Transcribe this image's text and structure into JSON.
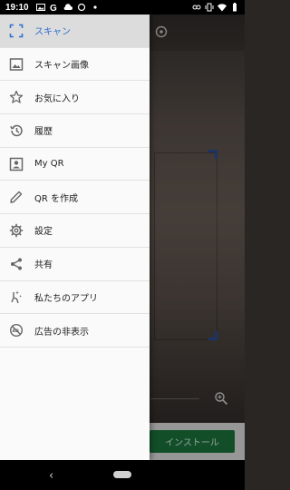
{
  "status_bar": {
    "time": "19:10",
    "left_icons": [
      "image-icon",
      "google-icon",
      "cloud-icon",
      "sync-icon",
      "dot-icon"
    ],
    "right_icons": [
      "link-icon",
      "vibrate-icon",
      "wifi-icon",
      "battery-icon"
    ]
  },
  "drawer": {
    "items": [
      {
        "label": "スキャン",
        "icon": "scan-icon",
        "active": true
      },
      {
        "label": "スキャン画像",
        "icon": "image-icon",
        "active": false
      },
      {
        "label": "お気に入り",
        "icon": "star-icon",
        "active": false
      },
      {
        "label": "履歴",
        "icon": "history-icon",
        "active": false
      },
      {
        "label": "My QR",
        "icon": "contact-card-icon",
        "active": false
      },
      {
        "label": "QR を作成",
        "icon": "pencil-icon",
        "active": false
      },
      {
        "label": "設定",
        "icon": "gear-icon",
        "active": false
      },
      {
        "label": "共有",
        "icon": "share-icon",
        "active": false
      },
      {
        "label": "私たちのアプリ",
        "icon": "apps-icon",
        "active": false
      },
      {
        "label": "広告の非表示",
        "icon": "no-ads-icon",
        "active": false
      }
    ]
  },
  "ad": {
    "install_label": "インストール"
  },
  "colors": {
    "accent": "#2f6fd0",
    "install_button": "#1c7a3f",
    "scan_frame": "#2b4fa0"
  },
  "navigation": {
    "back_glyph": "‹"
  }
}
